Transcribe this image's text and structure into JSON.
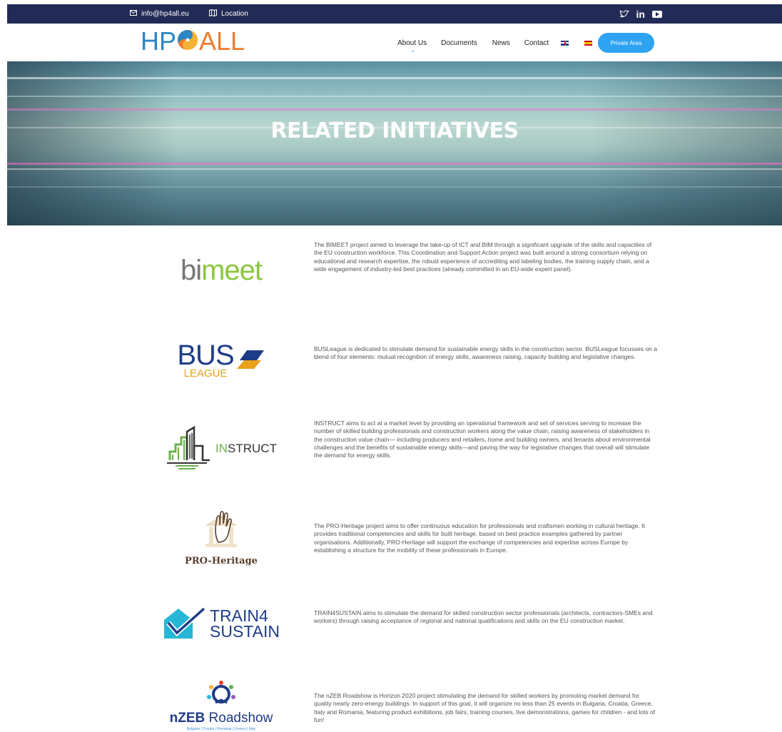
{
  "topbar": {
    "email": "info@hp4all.eu",
    "location": "Location",
    "social": [
      "twitter-icon",
      "linkedin-icon",
      "youtube-icon"
    ]
  },
  "header": {
    "logo_left": "HP",
    "logo_right": "ALL",
    "nav": [
      "About Us",
      "Documents",
      "News",
      "Contact"
    ],
    "private_area_label": "Private Area"
  },
  "hero": {
    "title": "RELATED INITIATIVES"
  },
  "initiatives": [
    {
      "logo_text": [
        "bi",
        "meet"
      ],
      "description": "The BIMEET project aimed to leverage the take-up of ICT and BIM through a significant upgrade of the skills and capacities of the EU construction workforce. This Coordination and Support Action project was built around a strong consortium relying on educational and research expertise, the robust experience of accrediting and labeling bodies, the training supply chain, and a wide engagement of industry-led best practices (already committed in an EU-wide expert panel)."
    },
    {
      "logo_text": [
        "BUS",
        "LEAGUE"
      ],
      "description": "BUSLeague is dedicated to stimulate demand for sustainable energy skills in the construction sector. BUSLeague focusses on a blend of four elements: mutual recognition of energy skills, awareness raising, capacity building and legislative changes."
    },
    {
      "logo_text": [
        "IN",
        "STRUCT"
      ],
      "description": "INSTRUCT aims to act at a market level by providing an operational framework and set of services serving to increase the number of skilled building professionals and construction workers along the value chain, raising awareness of stakeholders in the construction value chain— including producers and retailers, home and building owners, and tenants about environmental challenges and the benefits of sustainable energy skills—and paving the way for legislative changes that overall will stimulate the demand for energy skills."
    },
    {
      "logo_text": [
        "PRO-Heritage"
      ],
      "description": "The PRO-Heritage project aims to offer continuous education for professionals and craftsmen working in cultural heritage. It provides traditional competencies and skills for built heritage, based on best practice examples gathered by partner organisations. Additionally, PRO-Heritage will support the exchange of competencies and expertise across Europe by establishing a structure for the mobility of these professionals in Europe."
    },
    {
      "logo_text": [
        "TRAIN4",
        "SUSTAIN"
      ],
      "description": "TRAIN4SUSTAIN aims to stimulate the demand for skilled construction sector professionals (architects, contractors-SMEs and workers) through raising acceptance of regional and national qualifications and skills on the EU construction market."
    },
    {
      "logo_text": [
        "nZEB",
        "Roadshow",
        "Bulgaria | Croatia | Romania | Greece | Italy"
      ],
      "description": "The nZEB Roadshow is Horizon 2020 project stimulating the demand for skilled workers by promoting market demand for quality nearly zero-energy buildings. In support of this goal, it will organize no less than 25 events in Bulgaria, Croatia, Greece, Italy and Romania, featuring product exhibitions, job fairs, training courses, live demonstrations, games for children - and lots of fun!"
    }
  ],
  "colors": {
    "topbar_bg": "#222b55",
    "accent": "#2ea3f2",
    "logo_blue": "#2b86c5",
    "logo_orange": "#f07a2a"
  }
}
